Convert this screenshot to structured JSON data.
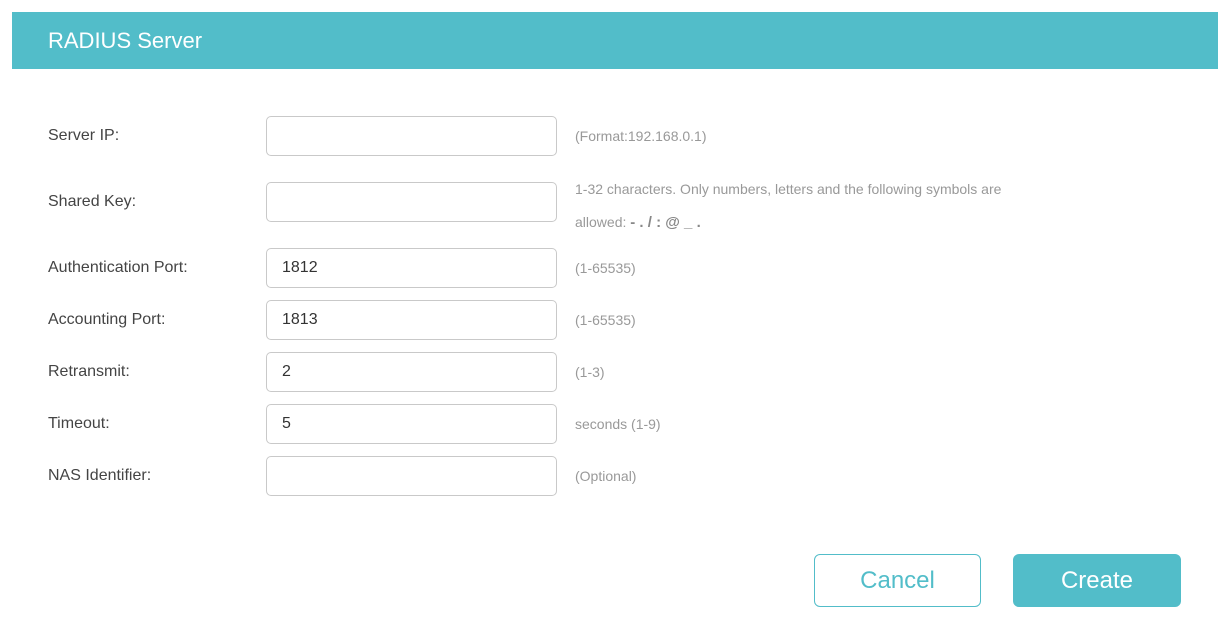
{
  "dialog": {
    "title": "RADIUS Server"
  },
  "fields": {
    "server_ip": {
      "label": "Server IP:",
      "value": "",
      "hint": "(Format:192.168.0.1)"
    },
    "shared_key": {
      "label": "Shared Key:",
      "value": "",
      "hint_line1": "1-32 characters. Only numbers, letters and the following symbols are",
      "hint_line2_prefix": "allowed: ",
      "hint_symbols": "- . / : @ _ ."
    },
    "auth_port": {
      "label": "Authentication Port:",
      "value": "1812",
      "hint": "(1-65535)"
    },
    "acct_port": {
      "label": "Accounting Port:",
      "value": "1813",
      "hint": "(1-65535)"
    },
    "retransmit": {
      "label": "Retransmit:",
      "value": "2",
      "hint": "(1-3)"
    },
    "timeout": {
      "label": "Timeout:",
      "value": "5",
      "hint": "seconds (1-9)"
    },
    "nas_identifier": {
      "label": "NAS Identifier:",
      "value": "",
      "hint": "(Optional)"
    }
  },
  "buttons": {
    "cancel_label": "Cancel",
    "create_label": "Create"
  },
  "colors": {
    "accent": "#52bdc9",
    "label_text": "#444444",
    "hint_text": "#999999",
    "input_border": "#c9c9c9"
  }
}
